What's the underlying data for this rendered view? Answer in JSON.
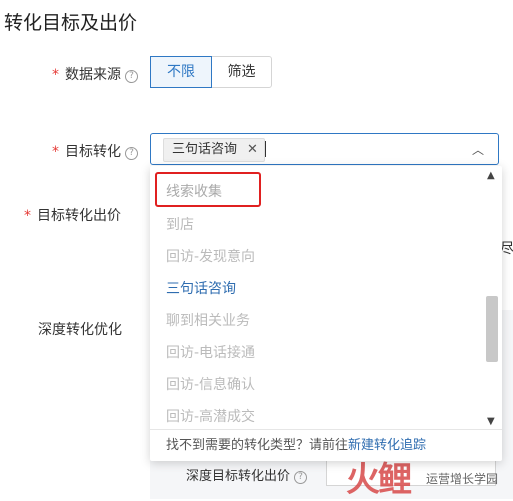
{
  "page": {
    "title": "转化目标及出价"
  },
  "data_source": {
    "label": "数据来源",
    "required_mark": "*",
    "help_icon": "question-circle-icon",
    "options": [
      "不限",
      "筛选"
    ],
    "selected": "不限"
  },
  "target_conversion": {
    "label": "目标转化",
    "required_mark": "*",
    "help_icon": "question-circle-icon",
    "selected_tag": "三句话咨询",
    "tag_remove_icon": "close-icon",
    "dropdown_icon": "chevron-up-icon"
  },
  "target_bid": {
    "label": "目标转化出价",
    "required_mark": "*"
  },
  "deep_conversion": {
    "label": "深度转化优化"
  },
  "dropdown": {
    "options": [
      {
        "label": "线索收集",
        "state": "highlighted"
      },
      {
        "label": "到店",
        "state": "disabled"
      },
      {
        "label": "回访-发现意向",
        "state": "disabled"
      },
      {
        "label": "三句话咨询",
        "state": "selected"
      },
      {
        "label": "聊到相关业务",
        "state": "disabled"
      },
      {
        "label": "回访-电话接通",
        "state": "disabled"
      },
      {
        "label": "回访-信息确认",
        "state": "disabled"
      },
      {
        "label": "回访-高潜成交",
        "state": "disabled"
      }
    ],
    "footer_text": "找不到需要的转化类型？请前往",
    "footer_link": "新建转化追踪",
    "scroll_up_icon": "chevron-up-icon",
    "scroll_down_icon": "chevron-down-icon"
  },
  "deep_bid": {
    "label": "深度目标转化出价",
    "help_icon": "question-circle-icon"
  },
  "partial_text": {
    "right_edge": "尽"
  },
  "watermark": {
    "text": "火鲤",
    "sub": "运营增长学园"
  },
  "colors": {
    "accent": "#2f78c4",
    "highlight_border": "#e02020",
    "required": "#e53935"
  }
}
